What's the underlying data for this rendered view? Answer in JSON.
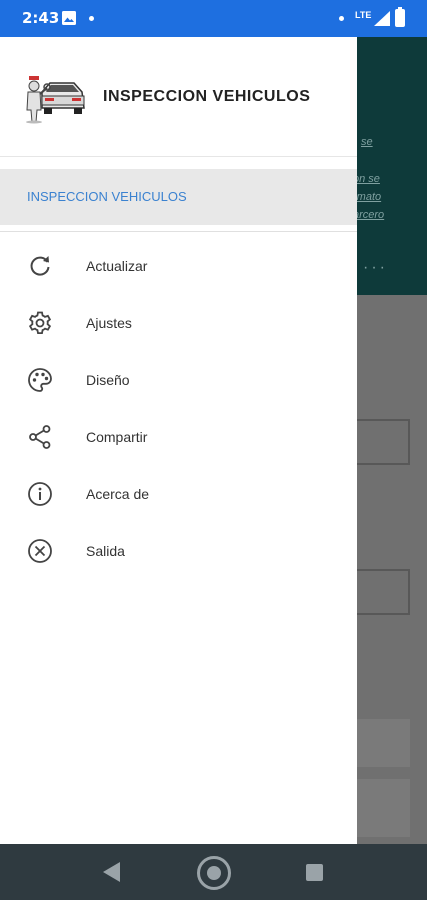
{
  "status_bar": {
    "time": "2:43",
    "network": "LTE"
  },
  "app": {
    "title": "INSPECCION VEHICULOS",
    "selected_item": "INSPECCION VEHICULOS",
    "accent_color": "#3b82d0"
  },
  "background_app": {
    "fragments": [
      "se",
      "on se",
      "rmato",
      "arcero"
    ]
  },
  "menu": {
    "items": [
      {
        "label": "Actualizar",
        "icon": "refresh-icon"
      },
      {
        "label": "Ajustes",
        "icon": "gear-icon"
      },
      {
        "label": "Diseño",
        "icon": "palette-icon"
      },
      {
        "label": "Compartir",
        "icon": "share-icon"
      },
      {
        "label": "Acerca de",
        "icon": "info-icon"
      },
      {
        "label": "Salida",
        "icon": "close-circle-icon"
      }
    ]
  }
}
